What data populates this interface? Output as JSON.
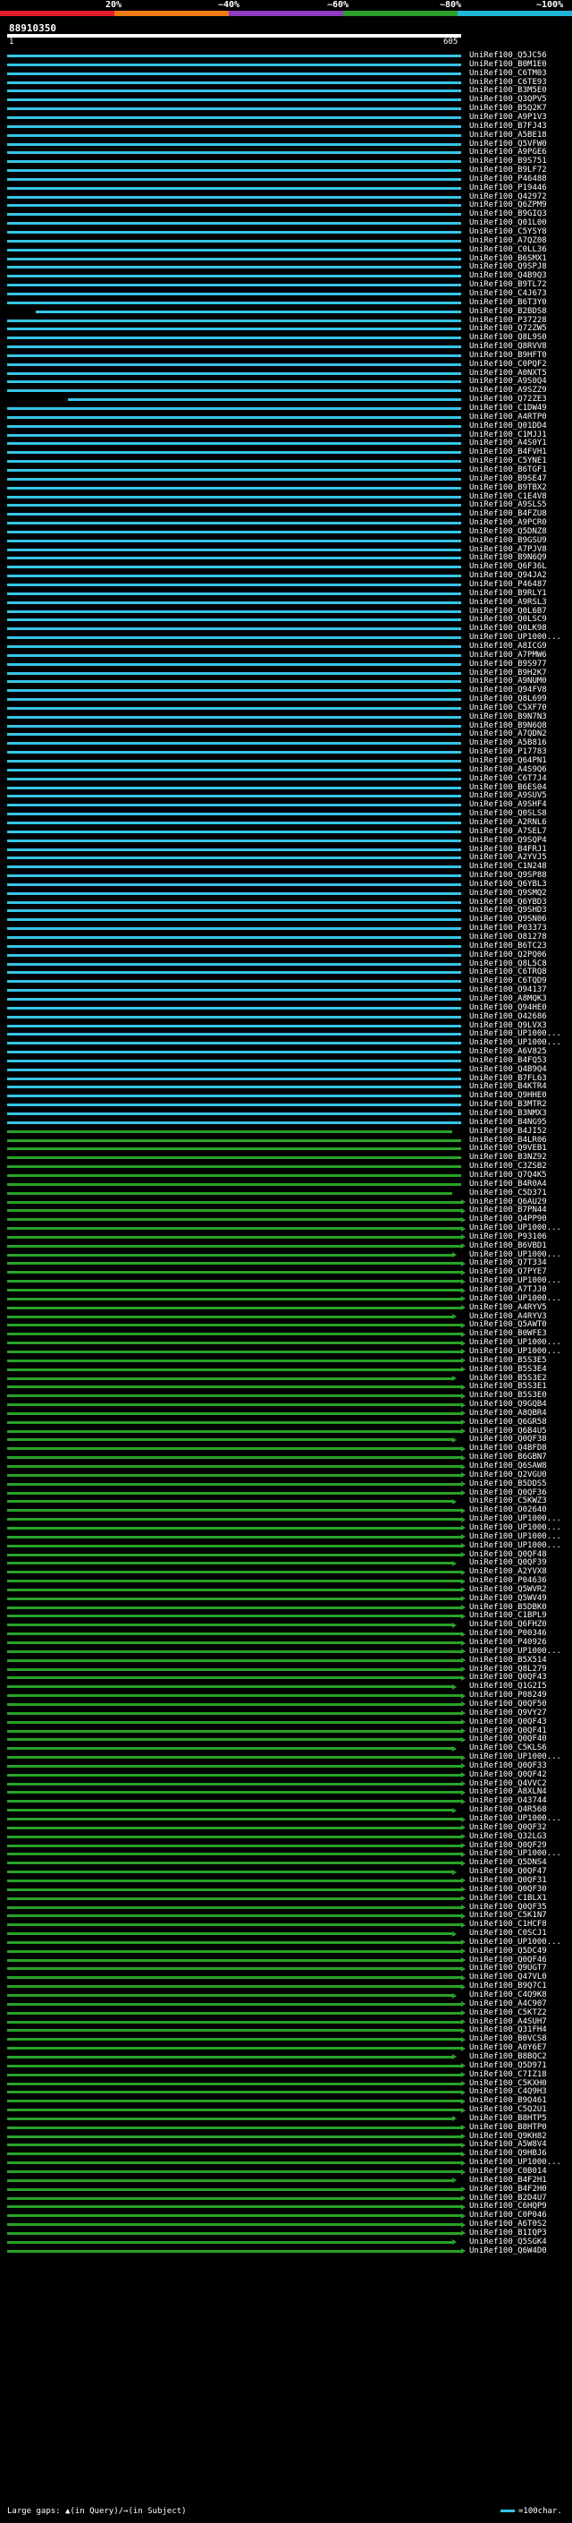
{
  "scale": {
    "labels": [
      "20%",
      "~40%",
      "~60%",
      "~80%",
      "~100%"
    ],
    "colors": [
      "#e11d2a",
      "#f07a12",
      "#8e3bbf",
      "#2a9d2a",
      "#1fb6d6"
    ]
  },
  "query": {
    "id": "88910350",
    "start": "1",
    "end": "605"
  },
  "legend": {
    "left": "Large gaps: ▲(in Query)/→(in Subject)",
    "right": "=100char."
  },
  "colors": {
    "cyan": "#35c5e5",
    "green": "#29a329",
    "black": "#000000"
  },
  "hits": [
    "UniRef100_Q5JC56",
    "UniRef100_B0M1E0",
    "UniRef100_C6TM03",
    "UniRef100_C6TE93",
    "UniRef100_B3M5E0",
    "UniRef100_Q3QPV5",
    "UniRef100_B5Q2K7",
    "UniRef100_A9P1V3",
    "UniRef100_B7FJ43",
    "UniRef100_A5BE18",
    "UniRef100_Q5VFW0",
    "UniRef100_A9PGE6",
    "UniRef100_B9S751",
    "UniRef100_B9LF72",
    "UniRef100_P46488",
    "UniRef100_P19446",
    "UniRef100_Q42972",
    "UniRef100_Q6ZPM9",
    "UniRef100_B9GIQ3",
    "UniRef100_Q01L00",
    "UniRef100_C5YSY8",
    "UniRef100_A7QZ08",
    "UniRef100_C0LL36",
    "UniRef100_B6SMX1",
    "UniRef100_Q9SPJ8",
    "UniRef100_Q4B9Q3",
    "UniRef100_B9TL72",
    "UniRef100_C4J673",
    "UniRef100_B6T3Y0",
    "UniRef100_B2BDS8",
    "UniRef100_P37228",
    "UniRef100_Q72ZW5",
    "UniRef100_Q8L9S0",
    "UniRef100_Q8RVV8",
    "UniRef100_B9HFT0",
    "UniRef100_C0PQF2",
    "UniRef100_A0NXT5",
    "UniRef100_A9S0Q4",
    "UniRef100_A9SZZ9",
    "UniRef100_Q72ZE3",
    "UniRef100_C1DW49",
    "UniRef100_A4RTP0",
    "UniRef100_Q01DD4",
    "UniRef100_C1MJJ1",
    "UniRef100_A4S0Y1",
    "UniRef100_B4FVH1",
    "UniRef100_C5YNE1",
    "UniRef100_B6TGF1",
    "UniRef100_B9SE47",
    "UniRef100_B9TBX2",
    "UniRef100_C1E4V8",
    "UniRef100_A9SLS5",
    "UniRef100_B4FZU8",
    "UniRef100_A9PCR0",
    "UniRef100_Q5DNZ8",
    "UniRef100_B9GSU9",
    "UniRef100_A7PJV8",
    "UniRef100_B9N6Q9",
    "UniRef100_Q6F36L",
    "UniRef100_Q94JA2",
    "UniRef100_P46487",
    "UniRef100_B9RLY1",
    "UniRef100_A9RSL3",
    "UniRef100_Q0L6B7",
    "UniRef100_Q0LSC9",
    "UniRef100_Q0LK98",
    "UniRef100_UP1000...",
    "UniRef100_A8ICG9",
    "UniRef100_A7PMW6",
    "UniRef100_B9S977",
    "UniRef100_B9H2K7",
    "UniRef100_A9NUM0",
    "UniRef100_Q94FV8",
    "UniRef100_Q8L699",
    "UniRef100_C5XF70",
    "UniRef100_B9N7N3",
    "UniRef100_B9N6Q8",
    "UniRef100_A7QDN2",
    "UniRef100_A5B816",
    "UniRef100_P17783",
    "UniRef100_Q64PN1",
    "UniRef100_A4S9Q6",
    "UniRef100_C6T7J4",
    "UniRef100_B6ES04",
    "UniRef100_A9SUV5",
    "UniRef100_A9SHF4",
    "UniRef100_Q0SLS8",
    "UniRef100_A2RNL6",
    "UniRef100_A7SEL7",
    "UniRef100_Q9SQP4",
    "UniRef100_B4FRJ1",
    "UniRef100_A2YVJ5",
    "UniRef100_C1N248",
    "UniRef100_Q9SP88",
    "UniRef100_Q6YBL3",
    "UniRef100_Q9SMQ2",
    "UniRef100_Q6YBD3",
    "UniRef100_Q9SHD3",
    "UniRef100_Q9SN06",
    "UniRef100_P03373",
    "UniRef100_O81278",
    "UniRef100_B6TC23",
    "UniRef100_Q2PQ06",
    "UniRef100_Q8L5C8",
    "UniRef100_C6TRQ8",
    "UniRef100_C6TQD9",
    "UniRef100_O94137",
    "UniRef100_A8MQK3",
    "UniRef100_Q94HE0",
    "UniRef100_O42686",
    "UniRef100_Q9LVX3",
    "UniRef100_UP1000...",
    "UniRef100_UP1000...",
    "UniRef100_A6V825",
    "UniRef100_B4FQ53",
    "UniRef100_Q4B9Q4",
    "UniRef100_B7FL63",
    "UniRef100_B4KTR4",
    "UniRef100_Q9HHE0",
    "UniRef100_B3MTR2",
    "UniRef100_B3NMX3",
    "UniRef100_B4NG95",
    "UniRef100_B4JI52",
    "UniRef100_B4LR06",
    "UniRef100_Q9VEB1",
    "UniRef100_B3NZ92",
    "UniRef100_C3ZSB2",
    "UniRef100_Q7Q4K5",
    "UniRef100_B4R0A4",
    "UniRef100_C5D371",
    "UniRef100_Q6AU29",
    "UniRef100_B7PN44",
    "UniRef100_Q4PP90",
    "UniRef100_UP1000...",
    "UniRef100_P93106",
    "UniRef100_B6VBD1",
    "UniRef100_UP1000...",
    "UniRef100_Q7T334",
    "UniRef100_Q7PYE7",
    "UniRef100_UP1000...",
    "UniRef100_A7TJJ0",
    "UniRef100_UP1000...",
    "UniRef100_A4RYV5",
    "UniRef100_A4RYV3",
    "UniRef100_Q5AWT0",
    "UniRef100_B0WFE3",
    "UniRef100_UP1000...",
    "UniRef100_UP1000...",
    "UniRef100_B5S3E5",
    "UniRef100_B5S3E4",
    "UniRef100_B5S3E2",
    "UniRef100_B5S3E1",
    "UniRef100_B5S3E0",
    "UniRef100_Q9GQB4",
    "UniRef100_A8QBR4",
    "UniRef100_Q6GR58",
    "UniRef100_Q6B4U5",
    "UniRef100_Q0QF38",
    "UniRef100_Q4BFD8",
    "UniRef100_B6GBN7",
    "UniRef100_Q6SAW8",
    "UniRef100_Q2VGU0",
    "UniRef100_B5DDS5",
    "UniRef100_Q0QF36",
    "UniRef100_C5KWZ3",
    "UniRef100_O02640",
    "UniRef100_UP1000...",
    "UniRef100_UP1000...",
    "UniRef100_UP1000...",
    "UniRef100_UP1000...",
    "UniRef100_Q0QF48",
    "UniRef100_Q0QF39",
    "UniRef100_A2YVX8",
    "UniRef100_P04636",
    "UniRef100_Q5WVR2",
    "UniRef100_Q5WV49",
    "UniRef100_B5DBK0",
    "UniRef100_C1BPL9",
    "UniRef100_Q6FHZ0",
    "UniRef100_P00346",
    "UniRef100_P40926",
    "UniRef100_UP1000...",
    "UniRef100_B5X514",
    "UniRef100_Q8L279",
    "UniRef100_Q0QF43",
    "UniRef100_Q1G2I5",
    "UniRef100_P08249",
    "UniRef100_Q0QF50",
    "UniRef100_Q9VY27",
    "UniRef100_Q0QF43",
    "UniRef100_Q0QF41",
    "UniRef100_Q0QF40",
    "UniRef100_C5KLS6",
    "UniRef100_UP1000...",
    "UniRef100_Q0QF33",
    "UniRef100_Q0QF42",
    "UniRef100_Q4VVC2",
    "UniRef100_A8XLN4",
    "UniRef100_O43744",
    "UniRef100_Q4R568",
    "UniRef100_UP1000...",
    "UniRef100_Q0QF32",
    "UniRef100_Q32LG3",
    "UniRef100_Q0QF29",
    "UniRef100_UP1000...",
    "UniRef100_Q5DNS4",
    "UniRef100_Q0QF47",
    "UniRef100_Q0QF31",
    "UniRef100_Q0QF30",
    "UniRef100_C1BLX1",
    "UniRef100_Q0QF35",
    "UniRef100_C5K1N7",
    "UniRef100_C1HCF8",
    "UniRef100_C0SCJ1",
    "UniRef100_UP1000...",
    "UniRef100_Q5DC49",
    "UniRef100_Q0QF46",
    "UniRef100_Q9UGT7",
    "UniRef100_Q47VL0",
    "UniRef100_B9Q7C1",
    "UniRef100_C4Q9K8",
    "UniRef100_A4C907",
    "UniRef100_C5KTZ2",
    "UniRef100_A4SUH7",
    "UniRef100_Q31FH4",
    "UniRef100_B0VCS8",
    "UniRef100_A0Y6E7",
    "UniRef100_B8BQC2",
    "UniRef100_Q5D971",
    "UniRef100_C7IZ18",
    "UniRef100_C5KXH0",
    "UniRef100_C4Q9H3",
    "UniRef100_B9Q461",
    "UniRef100_C5Q2U1",
    "UniRef100_B8HTP5",
    "UniRef100_B8HTP0",
    "UniRef100_Q9KH82",
    "UniRef100_A5W8V4",
    "UniRef100_Q9HBJ6",
    "UniRef100_UP1000...",
    "UniRef100_C0B014",
    "UniRef100_B4F2H1",
    "UniRef100_B4F2H0",
    "UniRef100_B2D4U7",
    "UniRef100_C6HQP9",
    "UniRef100_C0P046",
    "UniRef100_A6T0S2",
    "UniRef100_B1IQP3",
    "UniRef100_Q5SGK4",
    "UniRef100_Q6W4D0"
  ]
}
